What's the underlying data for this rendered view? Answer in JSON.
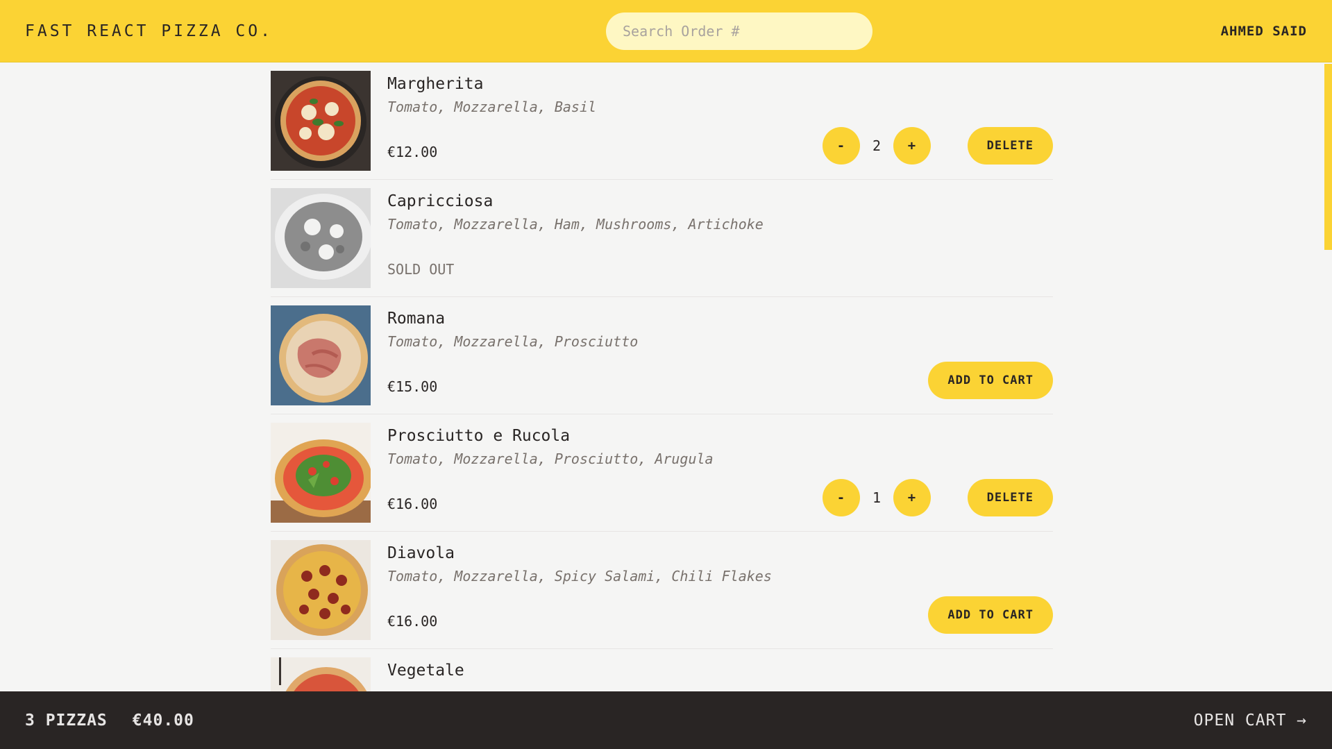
{
  "header": {
    "logo": "FAST REACT PIZZA CO.",
    "search_placeholder": "Search Order #",
    "username": "AHMED SAID"
  },
  "menu": {
    "items": [
      {
        "name": "Margherita",
        "ingredients": "Tomato, Mozzarella, Basil",
        "price": "€12.00",
        "state": "in_cart",
        "quantity": "2",
        "action_label": "DELETE",
        "decrement": "-",
        "increment": "+"
      },
      {
        "name": "Capricciosa",
        "ingredients": "Tomato, Mozzarella, Ham, Mushrooms, Artichoke",
        "price": "",
        "state": "sold_out",
        "sold_out_label": "SOLD OUT"
      },
      {
        "name": "Romana",
        "ingredients": "Tomato, Mozzarella, Prosciutto",
        "price": "€15.00",
        "state": "available",
        "action_label": "ADD TO CART"
      },
      {
        "name": "Prosciutto e Rucola",
        "ingredients": "Tomato, Mozzarella, Prosciutto, Arugula",
        "price": "€16.00",
        "state": "in_cart",
        "quantity": "1",
        "action_label": "DELETE",
        "decrement": "-",
        "increment": "+"
      },
      {
        "name": "Diavola",
        "ingredients": "Tomato, Mozzarella, Spicy Salami, Chili Flakes",
        "price": "€16.00",
        "state": "available",
        "action_label": "ADD TO CART"
      },
      {
        "name": "Vegetale",
        "ingredients": "",
        "price": "",
        "state": "partial"
      }
    ]
  },
  "footer": {
    "pizza_count": "3 PIZZAS",
    "total": "€40.00",
    "open_cart": "OPEN CART →"
  },
  "colors": {
    "accent": "#fbd334",
    "dark": "#292524",
    "background": "#f5f5f4"
  }
}
